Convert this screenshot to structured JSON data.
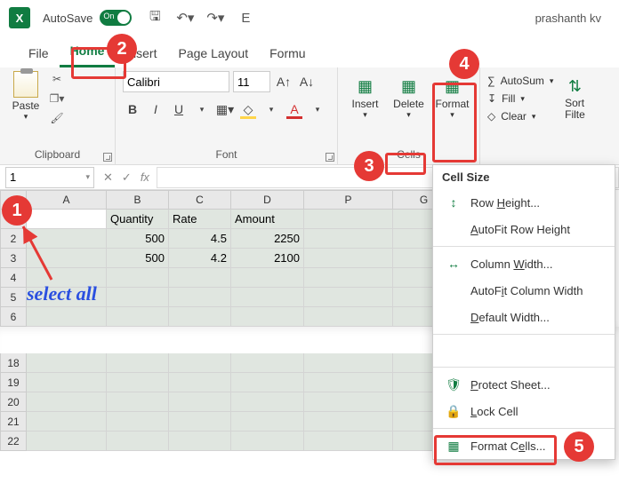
{
  "titlebar": {
    "autosave_label": "AutoSave",
    "autosave_state": "On",
    "user": "prashanth kv"
  },
  "tabs": {
    "file": "File",
    "home": "Home",
    "insert": "Insert",
    "page_layout": "Page Layout",
    "formulas": "Formu"
  },
  "ribbon": {
    "clipboard": {
      "paste": "Paste",
      "label": "Clipboard"
    },
    "font": {
      "name": "Calibri",
      "size": "11",
      "label": "Font",
      "bold": "B",
      "italic": "I",
      "underline": "U"
    },
    "cells": {
      "insert": "Insert",
      "delete": "Delete",
      "format": "Format",
      "label": "Cells"
    },
    "editing": {
      "autosum": "AutoSum",
      "fill": "Fill",
      "clear": "Clear",
      "sortfilter": "Sort\nFilte"
    }
  },
  "namebox": "1",
  "columns": [
    "A",
    "B",
    "C",
    "D",
    "P",
    "G"
  ],
  "rows_top": [
    1,
    2,
    3,
    4,
    5,
    6
  ],
  "rows_bottom": [
    18,
    19,
    20,
    21,
    22
  ],
  "table": {
    "headers": {
      "B": "Quantity",
      "C": "Rate",
      "D": "Amount"
    },
    "r2": {
      "B": "500",
      "C": "4.5",
      "D": "2250"
    },
    "r3": {
      "B": "500",
      "C": "4.2",
      "D": "2100"
    }
  },
  "menu": {
    "header": "Cell Size",
    "row_height": "Row Height...",
    "autofit_row": "AutoFit Row Height",
    "col_width": "Column Width...",
    "autofit_col": "AutoFit Column Width",
    "default_width": "Default Width...",
    "protect": "Protect Sheet...",
    "lock": "Lock Cell",
    "format_cells": "Format Cells..."
  },
  "annotations": {
    "selectall": "select all",
    "n1": "1",
    "n2": "2",
    "n3": "3",
    "n4": "4",
    "n5": "5"
  }
}
